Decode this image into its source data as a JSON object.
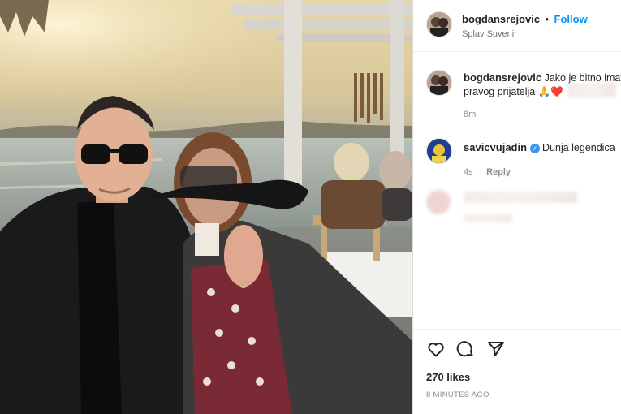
{
  "post": {
    "photo_alt": "Couple photo by the water",
    "author": {
      "username": "bogdansrejovic",
      "follow_label": "Follow",
      "location": "Splav Suvenir"
    },
    "caption": {
      "username": "bogdansrejovic",
      "text_line1": "Jako je bitno imat",
      "text_line2": "pravog prijatelja",
      "emoji": "🙏❤️",
      "time": "8m"
    },
    "comments": [
      {
        "username": "savicvujadin",
        "text": "Dunja legendica",
        "time": "4s",
        "reply_label": "Reply",
        "verified": true
      }
    ],
    "likes": "270 likes",
    "timestamp": "8 MINUTES AGO"
  },
  "colors": {
    "accent": "#0095f6",
    "verified": "#3897f0"
  },
  "icons": {
    "like": "heart-icon",
    "comment": "comment-icon",
    "share": "send-icon",
    "verified": "verified-badge-icon"
  }
}
